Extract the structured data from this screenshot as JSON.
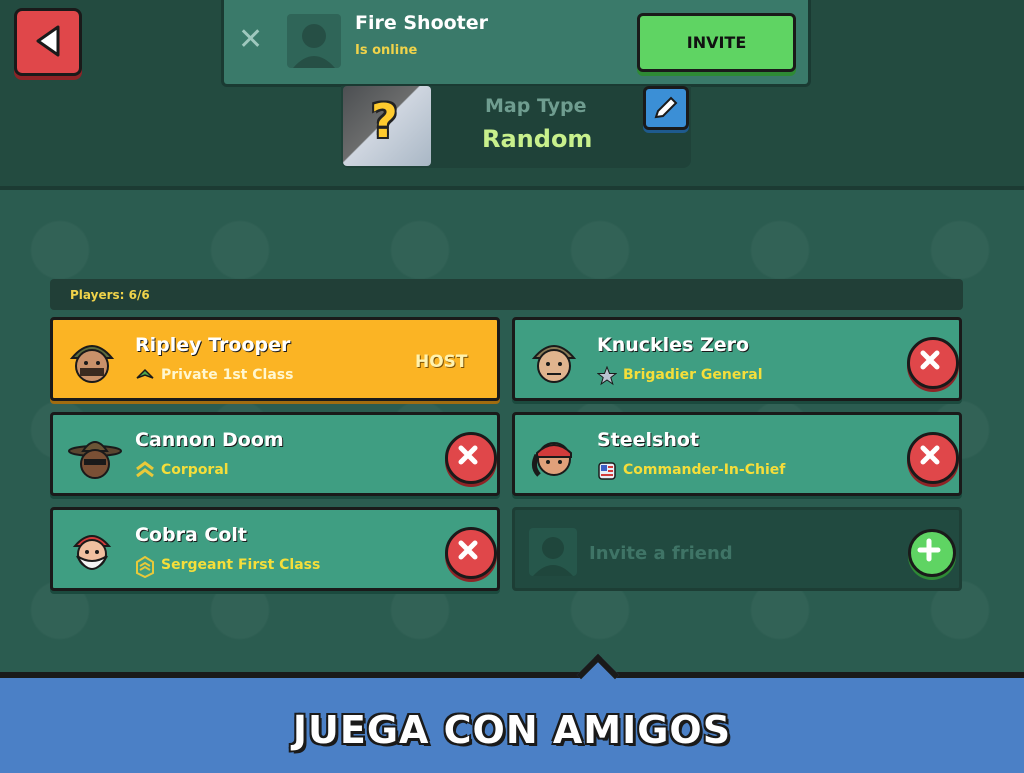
{
  "notification": {
    "close_icon": "close-icon",
    "friend_name": "Fire Shooter",
    "friend_status": "Is online",
    "invite_label": "INVITE"
  },
  "map": {
    "label": "Map Type",
    "value": "Random",
    "edit_icon": "pencil-icon"
  },
  "players": {
    "count_label": "Players: 6/6",
    "slots": [
      {
        "name": "Ripley Trooper",
        "rank": "Private 1st Class",
        "badge": "HOST",
        "is_host": true
      },
      {
        "name": "Knuckles Zero",
        "rank": "Brigadier General"
      },
      {
        "name": "Cannon Doom",
        "rank": "Corporal"
      },
      {
        "name": "Steelshot",
        "rank": "Commander-In-Chief"
      },
      {
        "name": "Cobra Colt",
        "rank": "Sergeant First Class"
      }
    ],
    "invite_slot_label": "Invite a friend"
  },
  "banner": {
    "text": "JUEGA CON AMIGOS"
  },
  "colors": {
    "host_card": "#fbb424",
    "player_card": "#3f9e82",
    "kick_button": "#e0474a",
    "add_button": "#5fd463",
    "rank_text": "#f5de3a",
    "banner": "#4b80c6"
  }
}
